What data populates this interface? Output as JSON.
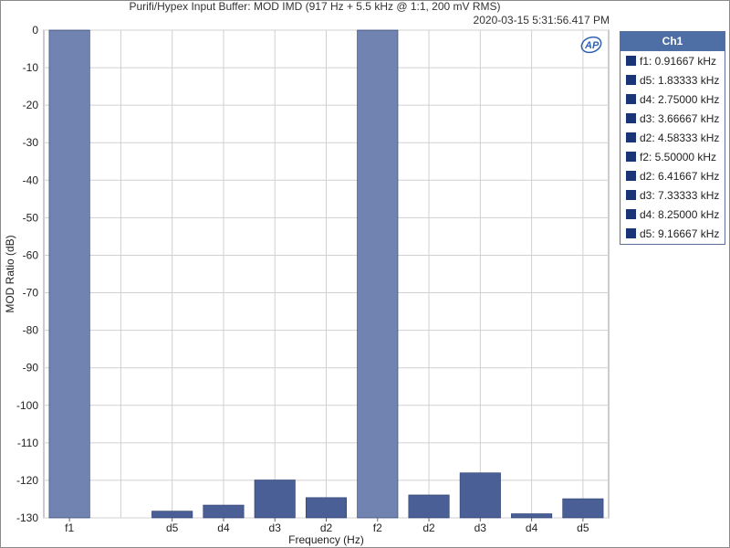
{
  "chart_data": {
    "type": "bar",
    "title": "Purifi/Hypex Input Buffer: MOD IMD (917 Hz + 5.5 kHz @ 1:1, 200 mV RMS)",
    "timestamp": "2020-03-15 5:31:56.417 PM",
    "xlabel": "Frequency (Hz)",
    "ylabel": "MOD Ratio (dB)",
    "ylim": [
      -130,
      0
    ],
    "yticks": [
      0,
      -10,
      -20,
      -30,
      -40,
      -50,
      -60,
      -70,
      -80,
      -90,
      -100,
      -110,
      -120,
      -130
    ],
    "grid": true,
    "legend_position": "right",
    "categories": [
      "f1",
      "",
      "d5",
      "d4",
      "d3",
      "d2",
      "f2",
      "d2",
      "d3",
      "d4",
      "d5"
    ],
    "values": [
      0,
      null,
      -128.2,
      -126.6,
      -119.9,
      -124.6,
      0,
      -123.9,
      -118.0,
      -128.9,
      -124.9
    ],
    "series": [
      {
        "name": "Ch1",
        "values": [
          0,
          null,
          -128.2,
          -126.6,
          -119.9,
          -124.6,
          0,
          -123.9,
          -118.0,
          -128.9,
          -124.9
        ]
      }
    ],
    "colors": {
      "fundamental": "#7083b1",
      "distortion": "#4b5f97",
      "bar_edge": "#2a3d6e"
    },
    "legend_title": "Ch1",
    "legend_items": [
      "f1: 0.91667 kHz",
      "d5: 1.83333 kHz",
      "d4: 2.75000 kHz",
      "d3: 3.66667 kHz",
      "d2: 4.58333 kHz",
      "f2: 5.50000 kHz",
      "d2: 6.41667 kHz",
      "d3: 7.33333 kHz",
      "d4: 8.25000 kHz",
      "d5: 9.16667 kHz"
    ],
    "legend_swatch_color": "#1a3577",
    "logo_text": "AP"
  }
}
